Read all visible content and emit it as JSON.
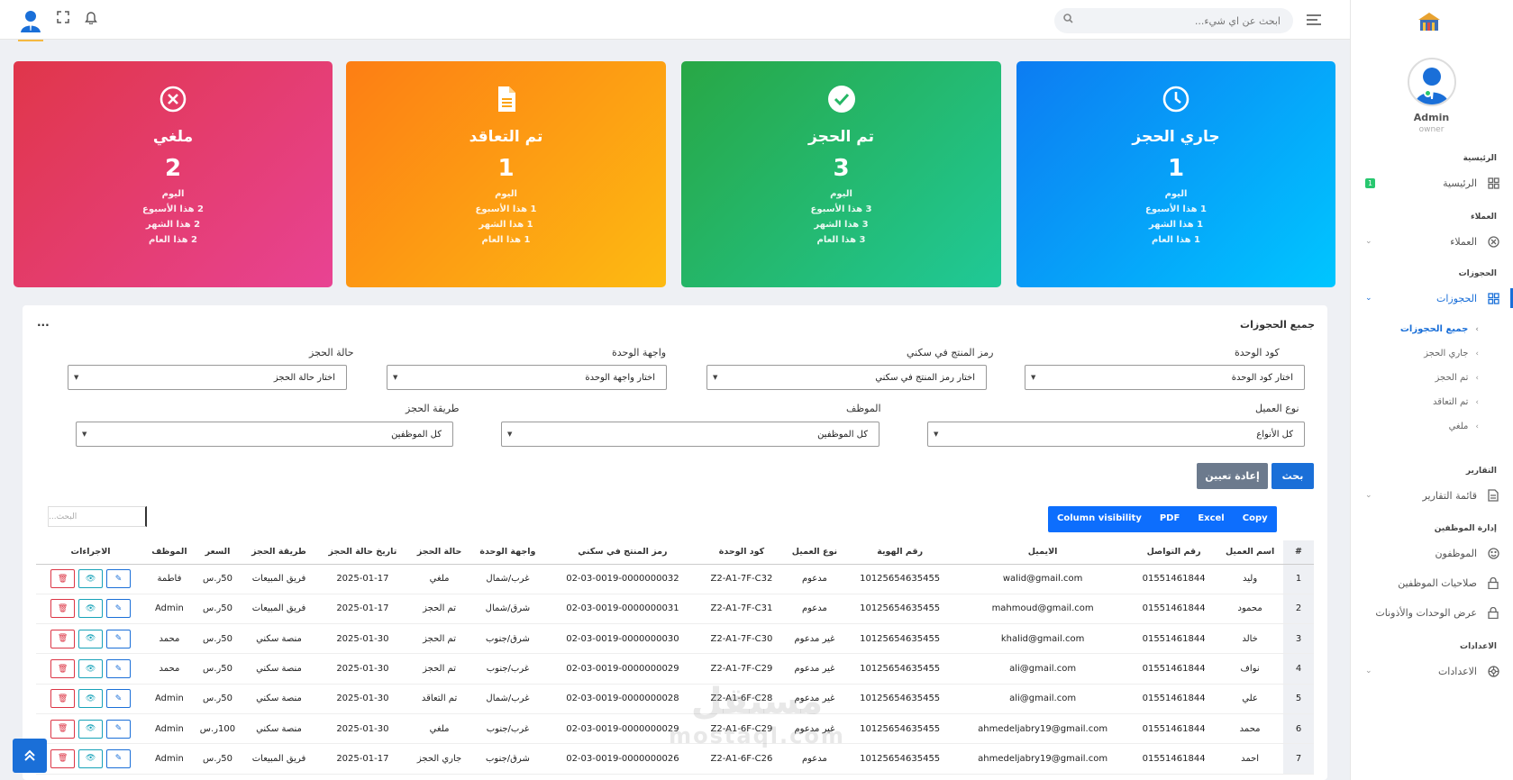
{
  "topbar": {
    "search_placeholder": "ابحث عن اي شيء...",
    "icons": [
      "user-icon",
      "fullscreen-icon",
      "bell-icon",
      "search-icon",
      "menu-icon"
    ]
  },
  "sidebar": {
    "user": {
      "name": "Admin",
      "role": "owner",
      "status_color": "#28c76f"
    },
    "sections": {
      "main": "الرئيسية",
      "clients": "العملاء",
      "bookings": "الحجوزات",
      "reports": "التقارير",
      "staff": "إدارة الموظفين",
      "settings": "الاعدادات"
    },
    "items": {
      "home": {
        "label": "الرئيسية",
        "badge": "1"
      },
      "clients": {
        "label": "العملاء"
      },
      "bookings": {
        "label": "الحجوزات"
      },
      "reports": {
        "label": "قائمة التقارير"
      },
      "employees": {
        "label": "الموظفون"
      },
      "permissions": {
        "label": "صلاحيات الموظفين"
      },
      "units_perms": {
        "label": "عرض الوحدات والأذونات"
      },
      "settings": {
        "label": "الاعدادات"
      }
    },
    "sub_items": [
      "جميع الحجوزات",
      "جاري الحجز",
      "تم الحجز",
      "تم التعاقد",
      "ملغي"
    ]
  },
  "cards": [
    {
      "title": "ملغي",
      "count": "2",
      "today": "اليوم",
      "week": "2 هذا الأسبوع",
      "month": "2 هذا الشهر",
      "year": "2 هذا العام",
      "colors": [
        "#e0364a",
        "#e84393"
      ],
      "icon": "x-circle-icon"
    },
    {
      "title": "تم التعاقد",
      "count": "1",
      "today": "اليوم",
      "week": "1 هذا الأسبوع",
      "month": "1 هذا الشهر",
      "year": "1 هذا العام",
      "colors": [
        "#fd7e14",
        "#fdba12"
      ],
      "icon": "document-icon"
    },
    {
      "title": "تم الحجز",
      "count": "3",
      "today": "اليوم",
      "week": "3 هذا الأسبوع",
      "month": "3 هذا الشهر",
      "year": "3 هذا العام",
      "colors": [
        "#28a745",
        "#20c997"
      ],
      "icon": "check-circle-icon"
    },
    {
      "title": "جاري الحجز",
      "count": "1",
      "today": "اليوم",
      "week": "1 هذا الأسبوع",
      "month": "1 هذا الشهر",
      "year": "1 هذا العام",
      "colors": [
        "#0d7cf2",
        "#00c6ff"
      ],
      "icon": "clock-icon"
    }
  ],
  "panel": {
    "title": "جميع الحجوزات",
    "dots": "...",
    "filters": {
      "unit_code": {
        "label": "كود الوحدة",
        "value": "اختار كود الوحدة"
      },
      "sky_code": {
        "label": "رمز المنتج في سكني",
        "value": "اختار رمز المنتج في سكني"
      },
      "facade": {
        "label": "واجهة الوحدة",
        "value": "اختار واجهة الوحدة"
      },
      "status": {
        "label": "حالة الحجز",
        "value": "اختار حالة الحجز"
      },
      "client_type": {
        "label": "نوع العميل",
        "value": "كل الأنواع"
      },
      "employee": {
        "label": "الموظف",
        "value": "كل الموظفين"
      },
      "method": {
        "label": "طريقة الحجز",
        "value": "كل الموظفين"
      }
    },
    "buttons": {
      "search": "بحث",
      "reset": "إعادة تعيين"
    },
    "export": [
      "Copy",
      "Excel",
      "PDF",
      "Column visibility"
    ],
    "table_search_placeholder": "البحث..."
  },
  "table": {
    "headers": [
      "#",
      "اسم العميل",
      "رقم التواصل",
      "الايميل",
      "رقم الهوية",
      "نوع العميل",
      "كود الوحدة",
      "رمز المنتج في سكني",
      "واجهة الوحدة",
      "حالة الحجز",
      "تاريخ حالة الحجز",
      "طريقة الحجز",
      "السعر",
      "الموظف",
      "الاجراءات"
    ],
    "rows": [
      [
        "1",
        "وليد",
        "01551461844",
        "walid@gmail.com",
        "10125654635455",
        "مدعوم",
        "Z2-A1-7F-C32",
        "02-03-0019-0000000032",
        "غرب/شمال",
        "ملغي",
        "2025-01-17",
        "فريق المبيعات",
        "50ر.س",
        "فاطمة"
      ],
      [
        "2",
        "محمود",
        "01551461844",
        "mahmoud@gmail.com",
        "10125654635455",
        "مدعوم",
        "Z2-A1-7F-C31",
        "02-03-0019-0000000031",
        "شرق/شمال",
        "تم الحجز",
        "2025-01-17",
        "فريق المبيعات",
        "50ر.س",
        "Admin"
      ],
      [
        "3",
        "خالد",
        "01551461844",
        "khalid@gmail.com",
        "10125654635455",
        "غير مدعوم",
        "Z2-A1-7F-C30",
        "02-03-0019-0000000030",
        "شرق/جنوب",
        "تم الحجز",
        "2025-01-30",
        "منصة سكني",
        "50ر.س",
        "محمد"
      ],
      [
        "4",
        "نواف",
        "01551461844",
        "ali@gmail.com",
        "10125654635455",
        "غير مدعوم",
        "Z2-A1-7F-C29",
        "02-03-0019-0000000029",
        "غرب/جنوب",
        "تم الحجز",
        "2025-01-30",
        "منصة سكني",
        "50ر.س",
        "محمد"
      ],
      [
        "5",
        "علي",
        "01551461844",
        "ali@gmail.com",
        "10125654635455",
        "غير مدعوم",
        "Z2-A1-6F-C28",
        "02-03-0019-0000000028",
        "غرب/شمال",
        "تم التعاقد",
        "2025-01-30",
        "منصة سكني",
        "50ر.س",
        "Admin"
      ],
      [
        "6",
        "محمد",
        "01551461844",
        "ahmedeljabry19@gmail.com",
        "10125654635455",
        "غير مدعوم",
        "Z2-A1-6F-C29",
        "02-03-0019-0000000029",
        "غرب/جنوب",
        "ملغي",
        "2025-01-30",
        "منصة سكني",
        "100ر.س",
        "Admin"
      ],
      [
        "7",
        "احمد",
        "01551461844",
        "ahmedeljabry19@gmail.com",
        "10125654635455",
        "مدعوم",
        "Z2-A1-6F-C26",
        "02-03-0019-0000000026",
        "شرق/جنوب",
        "جاري الحجز",
        "2025-01-17",
        "فريق المبيعات",
        "50ر.س",
        "Admin"
      ]
    ]
  },
  "watermark": {
    "line1": "مستقل",
    "line2": "mostaql.com"
  }
}
